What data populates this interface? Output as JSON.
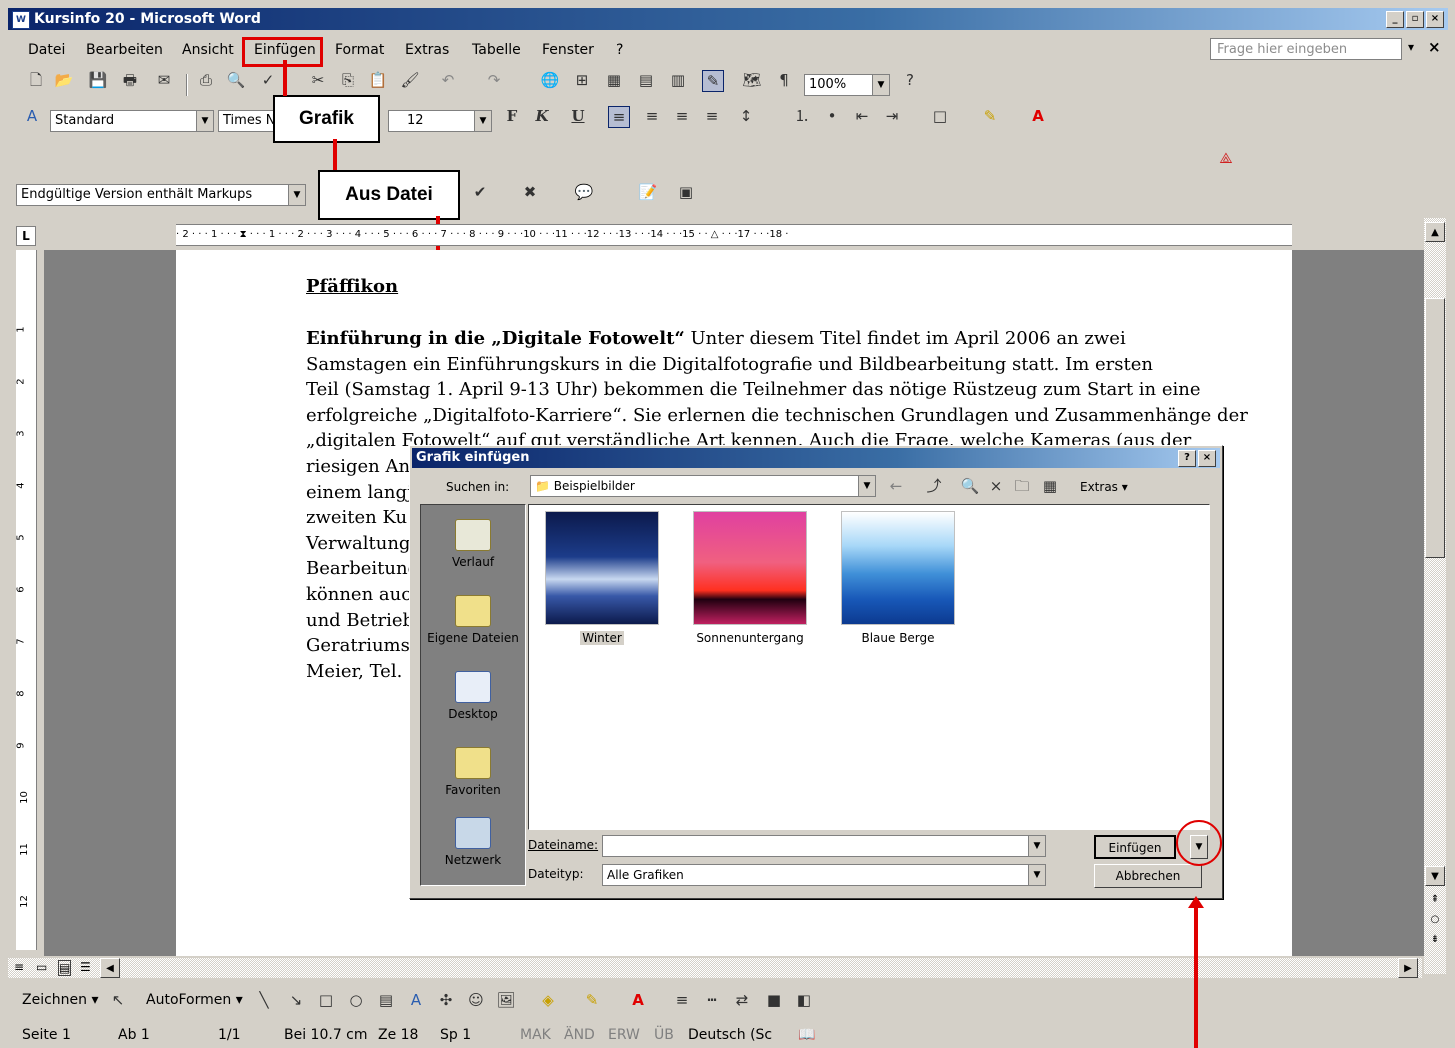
{
  "window": {
    "title": "Kursinfo 20 - Microsoft Word",
    "app_icon": "word-icon",
    "controls": [
      "_",
      " ",
      "x"
    ]
  },
  "menu": {
    "items": [
      "Datei",
      "Bearbeiten",
      "Ansicht",
      "Einfügen",
      "Format",
      "Extras",
      "Tabelle",
      "Fenster",
      "?"
    ],
    "ask_placeholder": "Frage hier eingeben"
  },
  "toolbar": {
    "zoom": "100%"
  },
  "format_toolbar": {
    "style": "Standard",
    "font": "Times N",
    "size": "12",
    "bold": "F",
    "italic": "K",
    "underline": "U"
  },
  "review_toolbar": {
    "markup": "Endgültige Version enthält Markups"
  },
  "callouts": {
    "grafik": "Grafik",
    "aus_datei": "Aus Datei"
  },
  "ruler": {
    "text": "· 2 · · · 1 · · · ⧗ · · · 1 · · · 2 · · · 3 · · · 4 · · · 5 · · · 6 · · · 7 · · · 8 · · · 9 · · ·10 · · ·11 · · ·12 · · ·13 · · ·14 · · ·15 · · △ · · ·17 · · ·18 ·"
  },
  "document": {
    "heading": "Pfäffikon",
    "lines": [
      {
        "bold": "Einführung in die „Digitale Fotowelt“",
        "rest": " Unter diesem Titel findet im April 2006 an zwei"
      },
      {
        "bold": "",
        "rest": "Samstagen ein Einführungskurs in die Digitalfotografie und Bildbearbeitung statt. Im ersten"
      },
      {
        "bold": "",
        "rest": "Teil (Samstag 1. April 9-13 Uhr) bekommen die Teilnehmer das nötige Rüstzeug zum Start in eine"
      },
      {
        "bold": "",
        "rest": "erfolgreiche „Digitalfoto-Karriere“. Sie erlernen die technischen Grundlagen und Zusammenhänge der"
      },
      {
        "bold": "",
        "rest": "„digitalen Fotowelt“ auf gut verständliche Art kennen. Auch die Frage, welche Kameras (aus der"
      },
      {
        "bold": "",
        "rest": "riesigen An"
      },
      {
        "bold": "",
        "rest": "einem langj"
      },
      {
        "bold": "",
        "rest": "zweiten Ku"
      },
      {
        "bold": "",
        "rest": "Verwaltung"
      },
      {
        "bold": "",
        "rest": "Bearbeitung"
      },
      {
        "bold": "",
        "rest": "können auc"
      },
      {
        "bold": "",
        "rest": "und Betrieb"
      },
      {
        "bold": "",
        "rest": "Geratriums"
      },
      {
        "bold": "",
        "rest": "Meier, Tel."
      }
    ]
  },
  "dialog": {
    "title": "Grafik einfügen",
    "title_buttons": [
      "?",
      "x"
    ],
    "look_in_label": "Suchen in:",
    "look_in_value": "Beispielbilder",
    "extras_label": "Extras ▾",
    "places": [
      "Verlauf",
      "Eigene Dateien",
      "Desktop",
      "Favoriten",
      "Netzwerk"
    ],
    "files": [
      {
        "name": "Winter",
        "selected": true
      },
      {
        "name": "Sonnenuntergang",
        "selected": false
      },
      {
        "name": "Blaue Berge",
        "selected": false
      }
    ],
    "filename_label": "Dateiname:",
    "filename_value": "",
    "filetype_label": "Dateityp:",
    "filetype_value": "Alle Grafiken",
    "insert_button": "Einfügen",
    "cancel_button": "Abbrechen"
  },
  "drawing_toolbar": {
    "draw": "Zeichnen ▾",
    "autoshapes": "AutoFormen ▾"
  },
  "status": {
    "page": "Seite 1",
    "section": "Ab 1",
    "pages": "1/1",
    "position": "Bei 10.7 cm",
    "line": "Ze 18",
    "col": "Sp 1",
    "mak": "MAK",
    "aend": "ÄND",
    "erw": "ERW",
    "ueb": "ÜB",
    "lang": "Deutsch (Sc"
  },
  "colors": {
    "accent": "#e00000",
    "title_start": "#0a246a",
    "title_end": "#a6caf0",
    "chrome": "#d4d0c8"
  }
}
